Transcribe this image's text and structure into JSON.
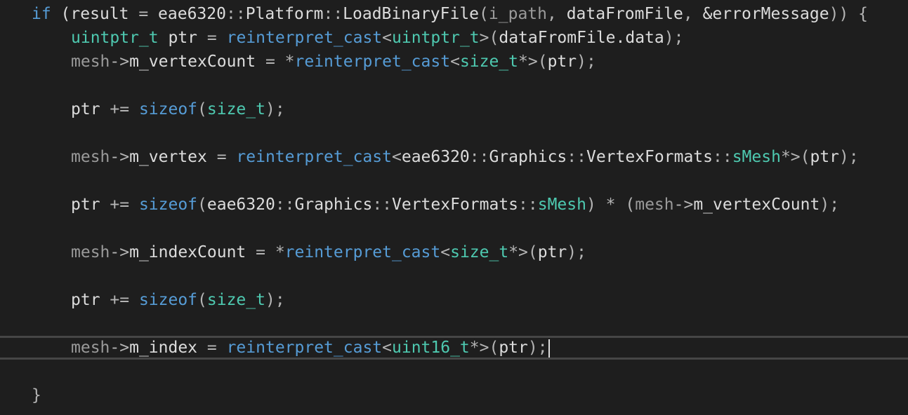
{
  "colors": {
    "background": "#1e1e1e",
    "keyword": "#569cd6",
    "type": "#4ec9b0",
    "identifier": "#dcdcdc",
    "punctuation": "#b4b4b4",
    "parameter": "#9a9a9a",
    "current_line_border": "#464646"
  },
  "lines": [
    {
      "tokens": [
        {
          "t": "if",
          "k": "kw"
        },
        {
          "t": " (",
          "k": "plain"
        },
        {
          "t": "result",
          "k": "ident"
        },
        {
          "t": " = ",
          "k": "op"
        },
        {
          "t": "eae6320",
          "k": "ident"
        },
        {
          "t": "::",
          "k": "punc"
        },
        {
          "t": "Platform",
          "k": "ident"
        },
        {
          "t": "::",
          "k": "punc"
        },
        {
          "t": "LoadBinaryFile",
          "k": "ident"
        },
        {
          "t": "(",
          "k": "punc"
        },
        {
          "t": "i_path",
          "k": "param"
        },
        {
          "t": ", ",
          "k": "punc"
        },
        {
          "t": "dataFromFile",
          "k": "ident"
        },
        {
          "t": ", ",
          "k": "punc"
        },
        {
          "t": "&errorMessage",
          "k": "ident"
        },
        {
          "t": ")) {",
          "k": "punc"
        }
      ]
    },
    {
      "indent": 1,
      "tokens": [
        {
          "t": "uintptr_t",
          "k": "type"
        },
        {
          "t": " ptr ",
          "k": "plain"
        },
        {
          "t": "=",
          "k": "op"
        },
        {
          "t": " ",
          "k": "plain"
        },
        {
          "t": "reinterpret_cast",
          "k": "kw"
        },
        {
          "t": "<",
          "k": "punc"
        },
        {
          "t": "uintptr_t",
          "k": "type"
        },
        {
          "t": ">(",
          "k": "punc"
        },
        {
          "t": "dataFromFile.data",
          "k": "ident"
        },
        {
          "t": ");",
          "k": "punc"
        }
      ]
    },
    {
      "indent": 1,
      "tokens": [
        {
          "t": "mesh",
          "k": "local"
        },
        {
          "t": "->",
          "k": "punc"
        },
        {
          "t": "m_vertexCount",
          "k": "ident"
        },
        {
          "t": " = ",
          "k": "op"
        },
        {
          "t": "*",
          "k": "op"
        },
        {
          "t": "reinterpret_cast",
          "k": "kw"
        },
        {
          "t": "<",
          "k": "punc"
        },
        {
          "t": "size_t",
          "k": "type"
        },
        {
          "t": "*>(",
          "k": "punc"
        },
        {
          "t": "ptr",
          "k": "ident"
        },
        {
          "t": ");",
          "k": "punc"
        }
      ]
    },
    {
      "tokens": []
    },
    {
      "indent": 1,
      "tokens": [
        {
          "t": "ptr",
          "k": "ident"
        },
        {
          "t": " += ",
          "k": "op"
        },
        {
          "t": "sizeof",
          "k": "kw"
        },
        {
          "t": "(",
          "k": "punc"
        },
        {
          "t": "size_t",
          "k": "type"
        },
        {
          "t": ");",
          "k": "punc"
        }
      ]
    },
    {
      "tokens": []
    },
    {
      "indent": 1,
      "tokens": [
        {
          "t": "mesh",
          "k": "local"
        },
        {
          "t": "->",
          "k": "punc"
        },
        {
          "t": "m_vertex",
          "k": "ident"
        },
        {
          "t": " = ",
          "k": "op"
        },
        {
          "t": "reinterpret_cast",
          "k": "kw"
        },
        {
          "t": "<",
          "k": "punc"
        },
        {
          "t": "eae6320",
          "k": "ident"
        },
        {
          "t": "::",
          "k": "punc"
        },
        {
          "t": "Graphics",
          "k": "ident"
        },
        {
          "t": "::",
          "k": "punc"
        },
        {
          "t": "VertexFormats",
          "k": "ident"
        },
        {
          "t": "::",
          "k": "punc"
        },
        {
          "t": "sMesh",
          "k": "type"
        },
        {
          "t": "*>(",
          "k": "punc"
        },
        {
          "t": "ptr",
          "k": "ident"
        },
        {
          "t": ");",
          "k": "punc"
        }
      ]
    },
    {
      "tokens": []
    },
    {
      "indent": 1,
      "tokens": [
        {
          "t": "ptr",
          "k": "ident"
        },
        {
          "t": " += ",
          "k": "op"
        },
        {
          "t": "sizeof",
          "k": "kw"
        },
        {
          "t": "(",
          "k": "punc"
        },
        {
          "t": "eae6320",
          "k": "ident"
        },
        {
          "t": "::",
          "k": "punc"
        },
        {
          "t": "Graphics",
          "k": "ident"
        },
        {
          "t": "::",
          "k": "punc"
        },
        {
          "t": "VertexFormats",
          "k": "ident"
        },
        {
          "t": "::",
          "k": "punc"
        },
        {
          "t": "sMesh",
          "k": "type"
        },
        {
          "t": ") * (",
          "k": "punc"
        },
        {
          "t": "mesh",
          "k": "local"
        },
        {
          "t": "->",
          "k": "punc"
        },
        {
          "t": "m_vertexCount",
          "k": "ident"
        },
        {
          "t": ");",
          "k": "punc"
        }
      ]
    },
    {
      "tokens": []
    },
    {
      "indent": 1,
      "tokens": [
        {
          "t": "mesh",
          "k": "local"
        },
        {
          "t": "->",
          "k": "punc"
        },
        {
          "t": "m_indexCount",
          "k": "ident"
        },
        {
          "t": " = ",
          "k": "op"
        },
        {
          "t": "*",
          "k": "op"
        },
        {
          "t": "reinterpret_cast",
          "k": "kw"
        },
        {
          "t": "<",
          "k": "punc"
        },
        {
          "t": "size_t",
          "k": "type"
        },
        {
          "t": "*>(",
          "k": "punc"
        },
        {
          "t": "ptr",
          "k": "ident"
        },
        {
          "t": ");",
          "k": "punc"
        }
      ]
    },
    {
      "tokens": []
    },
    {
      "indent": 1,
      "tokens": [
        {
          "t": "ptr",
          "k": "ident"
        },
        {
          "t": " += ",
          "k": "op"
        },
        {
          "t": "sizeof",
          "k": "kw"
        },
        {
          "t": "(",
          "k": "punc"
        },
        {
          "t": "size_t",
          "k": "type"
        },
        {
          "t": ");",
          "k": "punc"
        }
      ]
    },
    {
      "tokens": []
    },
    {
      "indent": 1,
      "current": true,
      "tokens": [
        {
          "t": "mesh",
          "k": "local"
        },
        {
          "t": "->",
          "k": "punc"
        },
        {
          "t": "m_index",
          "k": "ident"
        },
        {
          "t": " = ",
          "k": "op"
        },
        {
          "t": "reinterpret_cast",
          "k": "kw"
        },
        {
          "t": "<",
          "k": "punc"
        },
        {
          "t": "uint16_t",
          "k": "type"
        },
        {
          "t": "*>(",
          "k": "punc"
        },
        {
          "t": "ptr",
          "k": "ident"
        },
        {
          "t": ");",
          "k": "punc"
        }
      ]
    },
    {
      "tokens": []
    },
    {
      "tokens": [
        {
          "t": "}",
          "k": "punc"
        }
      ]
    }
  ]
}
